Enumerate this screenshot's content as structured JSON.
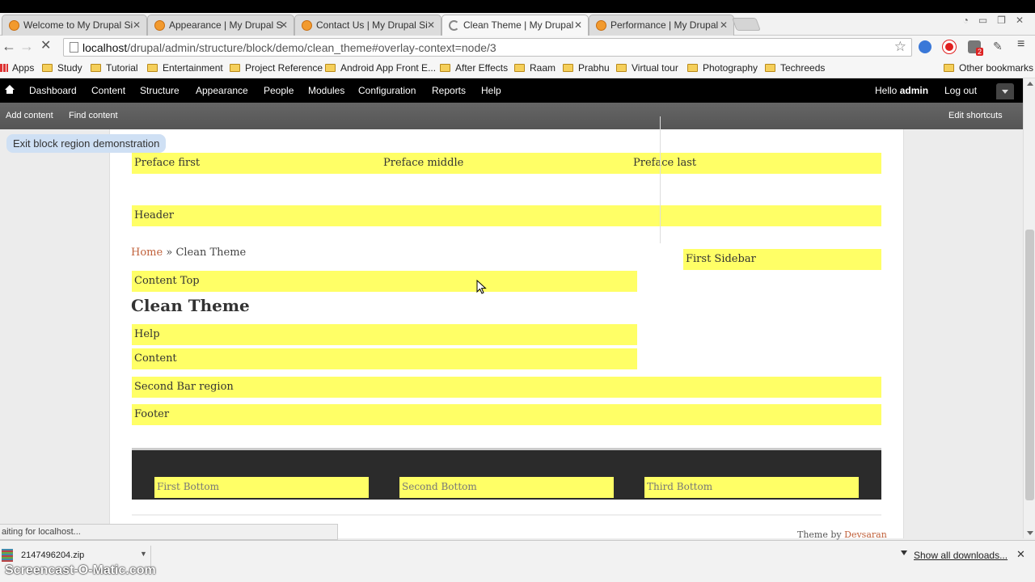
{
  "browser": {
    "tabs": [
      {
        "title": "Welcome to My Drupal Si"
      },
      {
        "title": "Appearance | My Drupal S"
      },
      {
        "title": "Contact Us | My Drupal Si"
      },
      {
        "title": "Clean Theme | My Drupal"
      },
      {
        "title": "Performance | My Drupal"
      }
    ],
    "tab_close": "✕",
    "url_host": "localhost",
    "url_path": "/drupal/admin/structure/block/demo/clean_theme#overlay-context=node/3",
    "bookmarks": [
      "Apps",
      "Study",
      "Tutorial",
      "Entertainment",
      "Project Reference",
      "Android App Front E...",
      "After Effects",
      "Raam",
      "Prabhu",
      "Virtual tour",
      "Photography",
      "Techreeds"
    ],
    "other_bookmarks": "Other bookmarks",
    "extension_badge": "2"
  },
  "toolbar": {
    "items": [
      "Dashboard",
      "Content",
      "Structure",
      "Appearance",
      "People",
      "Modules",
      "Configuration",
      "Reports",
      "Help"
    ],
    "hello": "Hello",
    "user": "admin",
    "logout": "Log out"
  },
  "shortcuts": {
    "add_content": "Add content",
    "find_content": "Find content",
    "edit_shortcuts": "Edit shortcuts"
  },
  "page": {
    "exit_demo": "Exit block region demonstration",
    "preface": [
      "Preface first",
      "Preface middle",
      "Preface last"
    ],
    "header": "Header",
    "breadcrumb_home": "Home",
    "breadcrumb_sep": "»",
    "breadcrumb_current": "Clean Theme",
    "content_top": "Content Top",
    "title": "Clean Theme",
    "help": "Help",
    "content": "Content",
    "first_sidebar": "First Sidebar",
    "second_bar": "Second Bar region",
    "footer": "Footer",
    "bottom_regions": [
      "First Bottom",
      "Second Bottom",
      "Third Bottom"
    ],
    "theme_by": "Theme by",
    "theme_author": "Devsaran"
  },
  "status": {
    "text": "aiting for localhost..."
  },
  "downloads": {
    "file": "2147496204.zip",
    "show_all": "Show all downloads...",
    "close": "✕"
  },
  "watermark": "Screencast-O-Matic.com",
  "colors": {
    "region_yellow": "#ffff66",
    "toolbar_black": "#000000",
    "link_orange": "#c0603a"
  }
}
